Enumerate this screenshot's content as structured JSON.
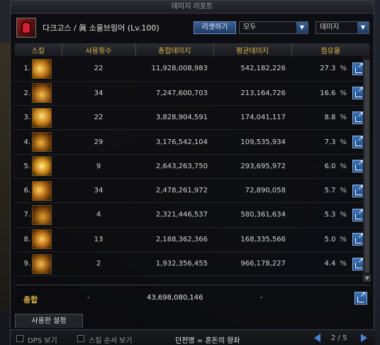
{
  "window": {
    "title": "데미지 리포트"
  },
  "header": {
    "player_name": "다크고스 / 眞 소울브링어 (Lv.100)",
    "reset_label": "리셋하기",
    "filter_value": "모두",
    "metric_value": "데미지"
  },
  "table": {
    "columns": [
      "스킬",
      "사용횟수",
      "총합데미지",
      "평균데미지",
      "점유율"
    ],
    "rows": [
      {
        "rank": "1.",
        "count": "22",
        "total": "11,928,008,983",
        "avg": "542,182,226",
        "share": "27.3"
      },
      {
        "rank": "2.",
        "count": "34",
        "total": "7,247,600,703",
        "avg": "213,164,726",
        "share": "16.6"
      },
      {
        "rank": "3.",
        "count": "22",
        "total": "3,828,904,591",
        "avg": "174,041,117",
        "share": "8.8"
      },
      {
        "rank": "4.",
        "count": "29",
        "total": "3,176,542,104",
        "avg": "109,535,934",
        "share": "7.3"
      },
      {
        "rank": "5.",
        "count": "9",
        "total": "2,643,263,750",
        "avg": "293,695,972",
        "share": "6.0"
      },
      {
        "rank": "6.",
        "count": "34",
        "total": "2,478,261,972",
        "avg": "72,890,058",
        "share": "5.7"
      },
      {
        "rank": "7.",
        "count": "4",
        "total": "2,321,446,537",
        "avg": "580,361,634",
        "share": "5.3"
      },
      {
        "rank": "8.",
        "count": "13",
        "total": "2,188,362,366",
        "avg": "168,335,566",
        "share": "5.0"
      },
      {
        "rank": "9.",
        "count": "2",
        "total": "1,932,356,455",
        "avg": "966,178,227",
        "share": "4.4"
      }
    ],
    "pct_symbol": "%"
  },
  "total": {
    "label": "총합",
    "count": "-",
    "value": "43,698,080,146",
    "avg": "-"
  },
  "tabs": {
    "used_settings": "사용한 설정"
  },
  "footer": {
    "dps_label": "DPS 보기",
    "skill_order_label": "스킬 순서 보기",
    "dungeon": "던전명 = 혼돈의 왕좌",
    "page": "2 / 5"
  },
  "colors": {
    "header_gold": "#e0b84a",
    "button_blue": "#3b5f92"
  },
  "icons": [
    "share-icon",
    "chevron-down-icon",
    "prev-page-icon",
    "next-page-icon"
  ]
}
